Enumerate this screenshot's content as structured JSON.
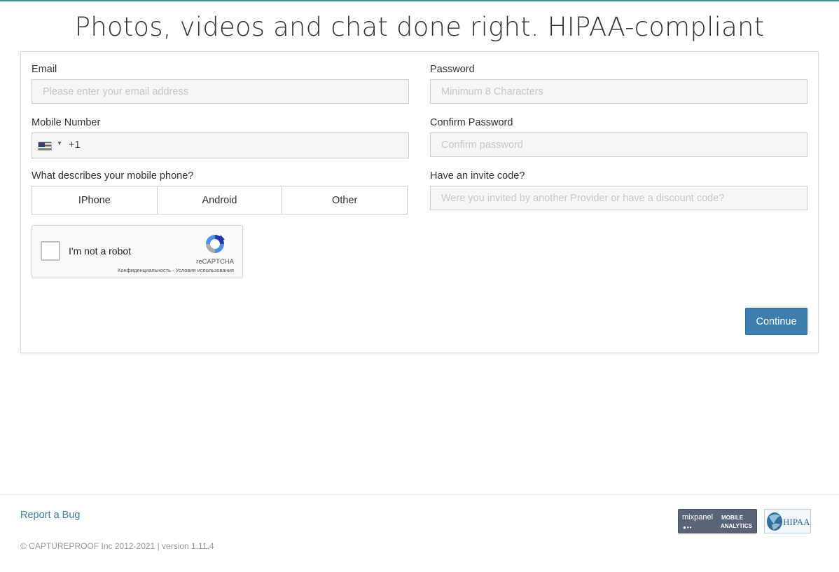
{
  "page": {
    "headline": "Photos, videos and chat done right. HIPAA-compliant"
  },
  "form": {
    "email": {
      "label": "Email",
      "placeholder": "Please enter your email address",
      "value": ""
    },
    "password": {
      "label": "Password",
      "placeholder": "Minimum 8 Characters",
      "value": ""
    },
    "mobile": {
      "label": "Mobile Number",
      "country_icon": "us-flag-icon",
      "dial_code": "+1"
    },
    "confirm_password": {
      "label": "Confirm Password",
      "placeholder": "Confirm password",
      "value": ""
    },
    "phone_type": {
      "label": "What describes your mobile phone?",
      "options": [
        "IPhone",
        "Android",
        "Other"
      ]
    },
    "invite": {
      "label": "Have an invite code?",
      "placeholder": "Were you invited by another Provider or have a discount code?",
      "value": ""
    },
    "captcha": {
      "checkbox_label": "I'm not a robot",
      "brand": "reCAPTCHA",
      "privacy": "Конфиденциальность",
      "separator": " - ",
      "terms": "Условия использования"
    },
    "continue_label": "Continue"
  },
  "footer": {
    "report_bug": "Report a Bug",
    "copyright": "© CAPTUREPROOF Inc 2012-2021 | version 1.11.4",
    "mixpanel": {
      "name": "mixpanel",
      "line1": "MOBILE",
      "line2": "ANALYTICS"
    },
    "hipaa": {
      "text": "HIPAA"
    }
  },
  "colors": {
    "accent": "#3f7fad",
    "top_border": "#3a9a8f",
    "mixpanel_badge": "#5a6479"
  }
}
